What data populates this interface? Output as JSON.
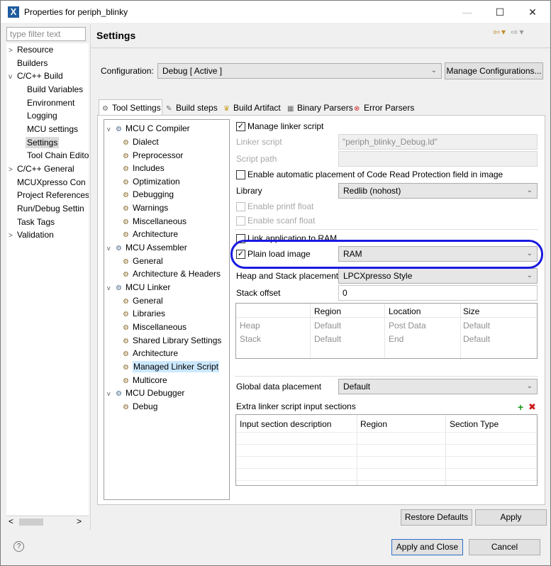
{
  "window": {
    "title": "Properties for periph_blinky",
    "app_icon": "X",
    "buttons": {
      "minimize": "—",
      "maximize": "☐",
      "close": "✕",
      "help": "?"
    }
  },
  "nav": {
    "filter_placeholder": "type filter text",
    "items": [
      {
        "label": "Resource",
        "arrow": ">"
      },
      {
        "label": "Builders",
        "arrow": ""
      },
      {
        "label": "C/C++ Build",
        "arrow": "v"
      },
      {
        "label": "Build Variables",
        "arrow": ""
      },
      {
        "label": "Environment",
        "arrow": ""
      },
      {
        "label": "Logging",
        "arrow": ""
      },
      {
        "label": "MCU settings",
        "arrow": ""
      },
      {
        "label": "Settings",
        "arrow": ""
      },
      {
        "label": "Tool Chain Edito",
        "arrow": ""
      },
      {
        "label": "C/C++ General",
        "arrow": ">"
      },
      {
        "label": "MCUXpresso Con",
        "arrow": ""
      },
      {
        "label": "Project References",
        "arrow": ""
      },
      {
        "label": "Run/Debug Settin",
        "arrow": ""
      },
      {
        "label": "Task Tags",
        "arrow": ""
      },
      {
        "label": "Validation",
        "arrow": ">"
      }
    ]
  },
  "page": {
    "title": "Settings",
    "config_label": "Configuration:",
    "config_value": "Debug  [ Active ]",
    "manage_button": "Manage Configurations..."
  },
  "tabs": [
    {
      "label": "Tool Settings",
      "icon": "⚙"
    },
    {
      "label": "Build steps",
      "icon": "✎"
    },
    {
      "label": "Build Artifact",
      "icon": "♛"
    },
    {
      "label": "Binary Parsers",
      "icon": "▦"
    },
    {
      "label": "Error Parsers",
      "icon": "⊗"
    }
  ],
  "tool_tree": {
    "groups": [
      {
        "label": "MCU C Compiler",
        "children": [
          "Dialect",
          "Preprocessor",
          "Includes",
          "Optimization",
          "Debugging",
          "Warnings",
          "Miscellaneous",
          "Architecture"
        ]
      },
      {
        "label": "MCU Assembler",
        "children": [
          "General",
          "Architecture & Headers"
        ]
      },
      {
        "label": "MCU Linker",
        "children": [
          "General",
          "Libraries",
          "Miscellaneous",
          "Shared Library Settings",
          "Architecture",
          "Managed Linker Script",
          "Multicore"
        ]
      },
      {
        "label": "MCU Debugger",
        "children": [
          "Debug"
        ]
      }
    ]
  },
  "form": {
    "manage_linker_script": "Manage linker script",
    "linker_script_label": "Linker script",
    "linker_script_value": "\"periph_blinky_Debug.ld\"",
    "script_path_label": "Script path",
    "crp_label": "Enable automatic placement of Code Read Protection field in image",
    "library_label": "Library",
    "library_value": "Redlib (nohost)",
    "printf_label": "Enable printf float",
    "scanf_label": "Enable scanf float",
    "link_ram_label": "Link application to RAM",
    "plain_load_label": "Plain load image",
    "plain_load_value": "RAM",
    "heap_label": "Heap and Stack placement",
    "heap_value": "LPCXpresso Style",
    "stack_offset_label": "Stack offset",
    "stack_offset_value": "0",
    "heap_table": {
      "columns": [
        "",
        "Region",
        "Location",
        "Size"
      ],
      "rows": [
        [
          "Heap",
          "Default",
          "Post Data",
          "Default"
        ],
        [
          "Stack",
          "Default",
          "End",
          "Default"
        ]
      ]
    },
    "global_label": "Global data placement",
    "global_value": "Default",
    "extra_label": "Extra linker script input sections",
    "extra_columns": [
      "Input section description",
      "Region",
      "Section Type"
    ],
    "add_icon": "+",
    "remove_icon": "✖"
  },
  "footer": {
    "restore": "Restore Defaults",
    "apply": "Apply",
    "apply_close": "Apply and Close",
    "cancel": "Cancel"
  },
  "colors": {
    "highlight": "#1a1ae0",
    "selection": "#cce8ff"
  }
}
